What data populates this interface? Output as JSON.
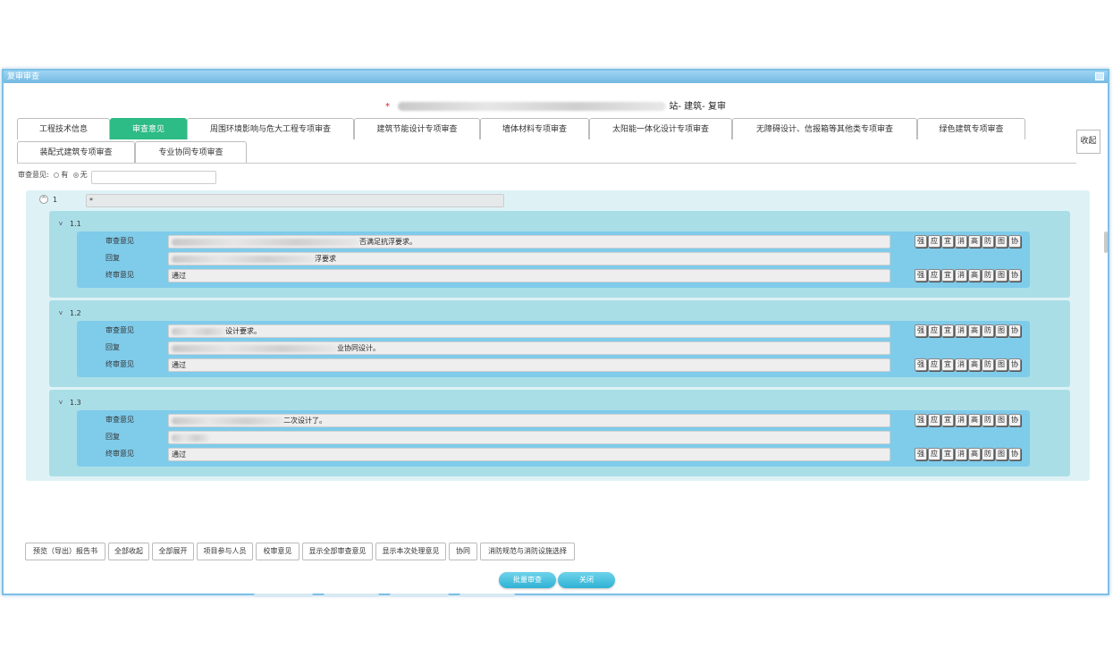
{
  "window": {
    "title": "复审审查"
  },
  "heading": {
    "required_mark": "*",
    "suffix": "站- 建筑- 复审"
  },
  "tabs": [
    {
      "label": "工程技术信息"
    },
    {
      "label": "审查意见"
    },
    {
      "label": "周围环境影响与危大工程专项审查"
    },
    {
      "label": "建筑节能设计专项审查"
    },
    {
      "label": "墙体材料专项审查"
    },
    {
      "label": "太阳能一体化设计专项审查"
    },
    {
      "label": "无障碍设计、信报箱等其他类专项审查"
    },
    {
      "label": "绿色建筑专项审查"
    },
    {
      "label": "装配式建筑专项审查"
    },
    {
      "label": "专业协同专项审查"
    }
  ],
  "collapse_label": "收起",
  "opinion": {
    "label": "审查意见:",
    "option_yes": "有",
    "option_no": "无",
    "selected": "无",
    "value": "无"
  },
  "group": {
    "toggle": "^",
    "number": "1",
    "title_value": "*"
  },
  "row_labels": {
    "review": "审查意见",
    "reply": "回复",
    "final": "终审意见"
  },
  "action_buttons": [
    "强",
    "应",
    "宜",
    "消",
    "高",
    "防",
    "图",
    "协"
  ],
  "sections": [
    {
      "toggle": "v",
      "number": "1.1",
      "review": "否满足抗浮要求。",
      "reply": "浮要求",
      "final": "通过"
    },
    {
      "toggle": "v",
      "number": "1.2",
      "review": "设计要求。",
      "reply": "业协同设计。",
      "final": "通过"
    },
    {
      "toggle": "v",
      "number": "1.3",
      "review": "二次设计了。",
      "reply": "",
      "final": "通过"
    }
  ],
  "bottom_buttons": [
    "预览（导出）报告书",
    "全部收起",
    "全部展开",
    "项目参与人员",
    "校审意见",
    "显示全部审查意见",
    "显示本次处理意见",
    "协同",
    "消防规范与消防设施选择"
  ],
  "footer_buttons": {
    "approve": "批量审查",
    "close": "关闭"
  }
}
